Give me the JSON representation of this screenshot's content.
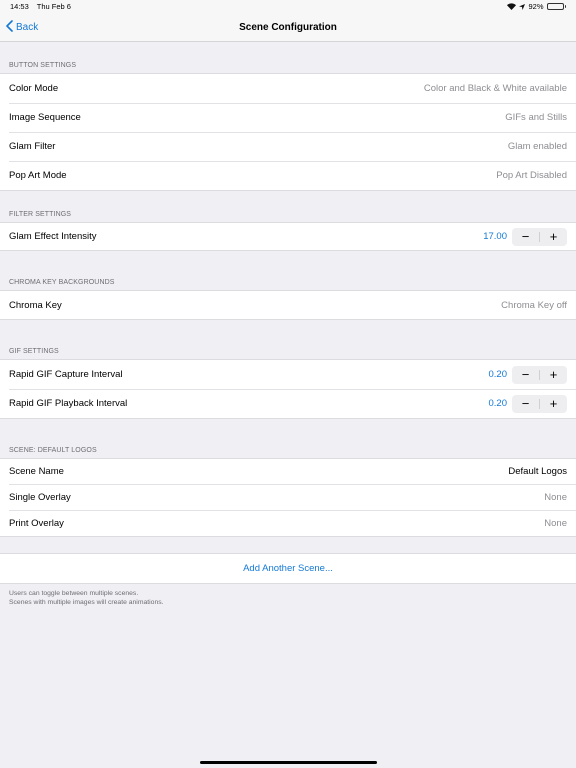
{
  "status_bar": {
    "time": "14:53",
    "date": "Thu Feb 6",
    "battery": "92%",
    "battery_level": 0.92
  },
  "nav": {
    "back_label": "Back",
    "title": "Scene Configuration"
  },
  "button_settings": {
    "header": "BUTTON SETTINGS",
    "rows": [
      {
        "label": "Color Mode",
        "value": "Color and Black & White available"
      },
      {
        "label": "Image Sequence",
        "value": "GIFs and Stills"
      },
      {
        "label": "Glam Filter",
        "value": "Glam enabled"
      },
      {
        "label": "Pop Art Mode",
        "value": "Pop Art Disabled"
      }
    ]
  },
  "filter_settings": {
    "header": "FILTER SETTINGS",
    "glam_label": "Glam Effect Intensity",
    "glam_value": "17.00"
  },
  "chroma": {
    "header": "CHROMA KEY BACKGROUNDS",
    "label": "Chroma Key",
    "value": "Chroma Key off"
  },
  "gif_settings": {
    "header": "GIF SETTINGS",
    "capture_label": "Rapid GIF Capture Interval",
    "capture_value": "0.20",
    "playback_label": "Rapid GIF Playback Interval",
    "playback_value": "0.20"
  },
  "scene": {
    "header": "SCENE: DEFAULT LOGOS",
    "rows": [
      {
        "label": "Scene Name",
        "value": "Default Logos"
      },
      {
        "label": "Single Overlay",
        "value": "None"
      },
      {
        "label": "Print Overlay",
        "value": "None"
      }
    ]
  },
  "add_scene_label": "Add Another Scene...",
  "footer": {
    "line1": "Users can toggle between multiple scenes.",
    "line2": "Scenes with multiple images will create animations."
  },
  "stepper": {
    "minus": "−",
    "plus": "+"
  }
}
